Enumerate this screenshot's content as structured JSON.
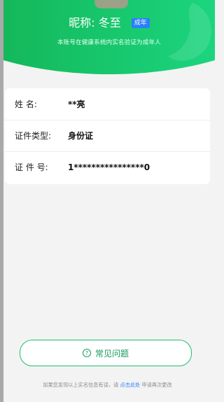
{
  "header": {
    "nickname_label": "昵称:",
    "nickname_value": "冬至",
    "badge": "成年",
    "subtitle": "本账号在健康系统内实名验证为成年人"
  },
  "identity": {
    "rows": [
      {
        "label": "姓 名:",
        "value": "**亮"
      },
      {
        "label": "证件类型:",
        "value": "身份证"
      },
      {
        "label": "证 件 号:",
        "value": "1****************0"
      }
    ]
  },
  "actions": {
    "faq_label": "常见问题"
  },
  "footer": {
    "prefix": "如果您发现以上实名信息有误，请",
    "link": "点击此处",
    "suffix": "申请再次更改"
  }
}
